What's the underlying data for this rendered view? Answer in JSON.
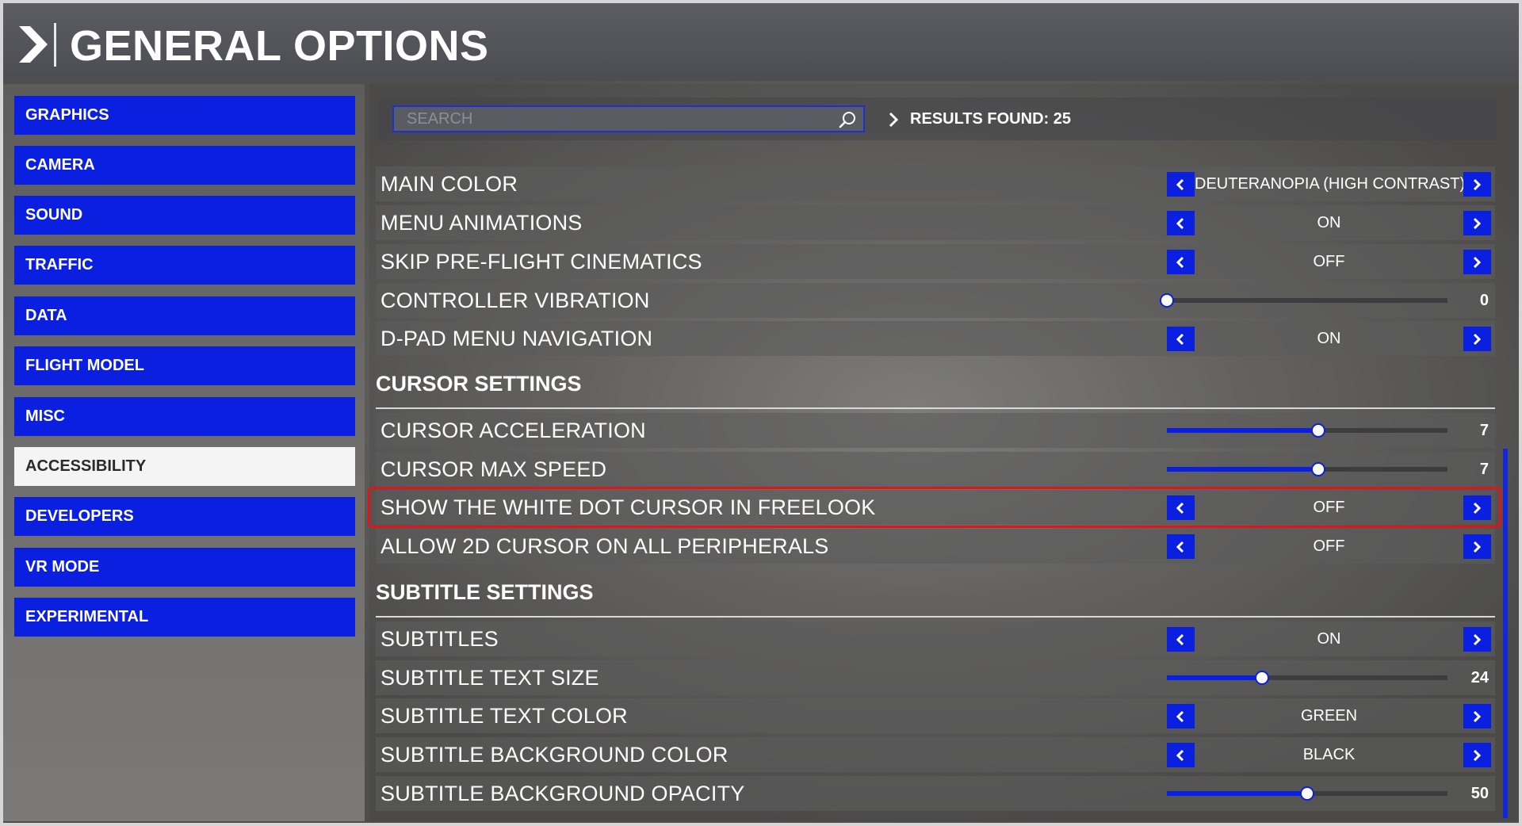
{
  "header": {
    "title": "GENERAL OPTIONS"
  },
  "sidebar": {
    "items": [
      {
        "label": "GRAPHICS",
        "active": false
      },
      {
        "label": "CAMERA",
        "active": false
      },
      {
        "label": "SOUND",
        "active": false
      },
      {
        "label": "TRAFFIC",
        "active": false
      },
      {
        "label": "DATA",
        "active": false
      },
      {
        "label": "FLIGHT MODEL",
        "active": false
      },
      {
        "label": "MISC",
        "active": false
      },
      {
        "label": "ACCESSIBILITY",
        "active": true
      },
      {
        "label": "DEVELOPERS",
        "active": false
      },
      {
        "label": "VR MODE",
        "active": false
      },
      {
        "label": "EXPERIMENTAL",
        "active": false
      }
    ]
  },
  "search": {
    "placeholder": "SEARCH",
    "value": ""
  },
  "results": {
    "label": "RESULTS FOUND: 25"
  },
  "sections": {
    "cursor": "CURSOR SETTINGS",
    "subtitle": "SUBTITLE SETTINGS"
  },
  "settings": {
    "main_color": {
      "label": "MAIN COLOR",
      "type": "option",
      "value": "DEUTERANOPIA (HIGH CONTRAST)"
    },
    "menu_animations": {
      "label": "MENU ANIMATIONS",
      "type": "option",
      "value": "ON"
    },
    "skip_cinematics": {
      "label": "SKIP PRE-FLIGHT CINEMATICS",
      "type": "option",
      "value": "OFF"
    },
    "controller_vibration": {
      "label": "CONTROLLER VIBRATION",
      "type": "slider",
      "value": "0",
      "fraction": 0.0
    },
    "dpad_navigation": {
      "label": "D-PAD MENU NAVIGATION",
      "type": "option",
      "value": "ON"
    },
    "cursor_acceleration": {
      "label": "CURSOR ACCELERATION",
      "type": "slider",
      "value": "7",
      "fraction": 0.54
    },
    "cursor_max_speed": {
      "label": "CURSOR MAX SPEED",
      "type": "slider",
      "value": "7",
      "fraction": 0.54
    },
    "white_dot_cursor": {
      "label": "SHOW THE WHITE DOT CURSOR IN FREELOOK",
      "type": "option",
      "value": "OFF",
      "highlighted": true
    },
    "cursor_2d": {
      "label": "ALLOW 2D CURSOR ON ALL PERIPHERALS",
      "type": "option",
      "value": "OFF"
    },
    "subtitles": {
      "label": "SUBTITLES",
      "type": "option",
      "value": "ON"
    },
    "subtitle_text_size": {
      "label": "SUBTITLE TEXT SIZE",
      "type": "slider",
      "value": "24",
      "fraction": 0.34
    },
    "subtitle_text_color": {
      "label": "SUBTITLE TEXT COLOR",
      "type": "option",
      "value": "GREEN"
    },
    "subtitle_bg_color": {
      "label": "SUBTITLE BACKGROUND COLOR",
      "type": "option",
      "value": "BLACK"
    },
    "subtitle_bg_opacity": {
      "label": "SUBTITLE BACKGROUND OPACITY",
      "type": "slider",
      "value": "50",
      "fraction": 0.5
    }
  },
  "colors": {
    "accent": "#0b1fe0",
    "highlight": "#e0141b",
    "active_tab": "#f4f4f4"
  },
  "icons": {
    "header": "chevron-right-icon",
    "search": "search-icon",
    "results": "chevron-right-icon",
    "prev": "chevron-left-icon",
    "next": "chevron-right-icon"
  }
}
